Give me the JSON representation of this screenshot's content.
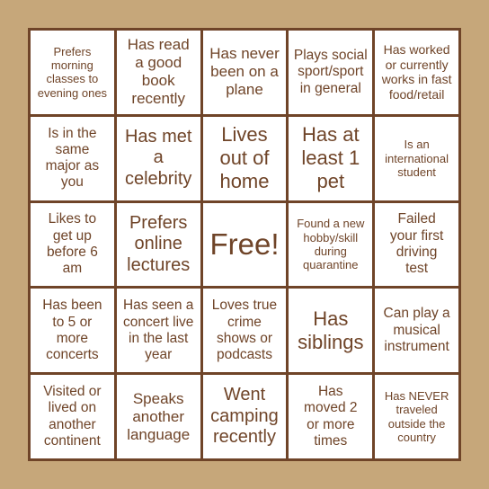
{
  "card": {
    "colors": {
      "background": "#C6A77A",
      "border": "#6F4428",
      "text": "#6F4428",
      "cell": "#FFFFFF"
    },
    "rows": [
      [
        {
          "text": "Prefers morning classes to evening ones"
        },
        {
          "text": "Has read a good book recently"
        },
        {
          "text": "Has never been on a plane"
        },
        {
          "text": "Plays social sport/sport in general"
        },
        {
          "text": "Has worked or currently works in fast food/retail"
        }
      ],
      [
        {
          "text": "Is in the same major as you"
        },
        {
          "text": "Has met a celebrity"
        },
        {
          "text": "Lives out of home"
        },
        {
          "text": "Has at least 1 pet"
        },
        {
          "text": "Is an international student"
        }
      ],
      [
        {
          "text": "Likes to get up before 6 am"
        },
        {
          "text": "Prefers online lectures"
        },
        {
          "text": "Free!"
        },
        {
          "text": "Found a new hobby/skill during quarantine"
        },
        {
          "text": "Failed your first driving test"
        }
      ],
      [
        {
          "text": "Has been to 5 or more concerts"
        },
        {
          "text": "Has seen a concert live in the last year"
        },
        {
          "text": "Loves true crime shows or podcasts"
        },
        {
          "text": "Has siblings"
        },
        {
          "text": "Can play a musical instrument"
        }
      ],
      [
        {
          "text": "Visited or lived on another continent"
        },
        {
          "text": "Speaks another language"
        },
        {
          "text": "Went camping recently"
        },
        {
          "text": "Has moved 2 or more times"
        },
        {
          "text": "Has NEVER traveled outside the country"
        }
      ]
    ]
  }
}
